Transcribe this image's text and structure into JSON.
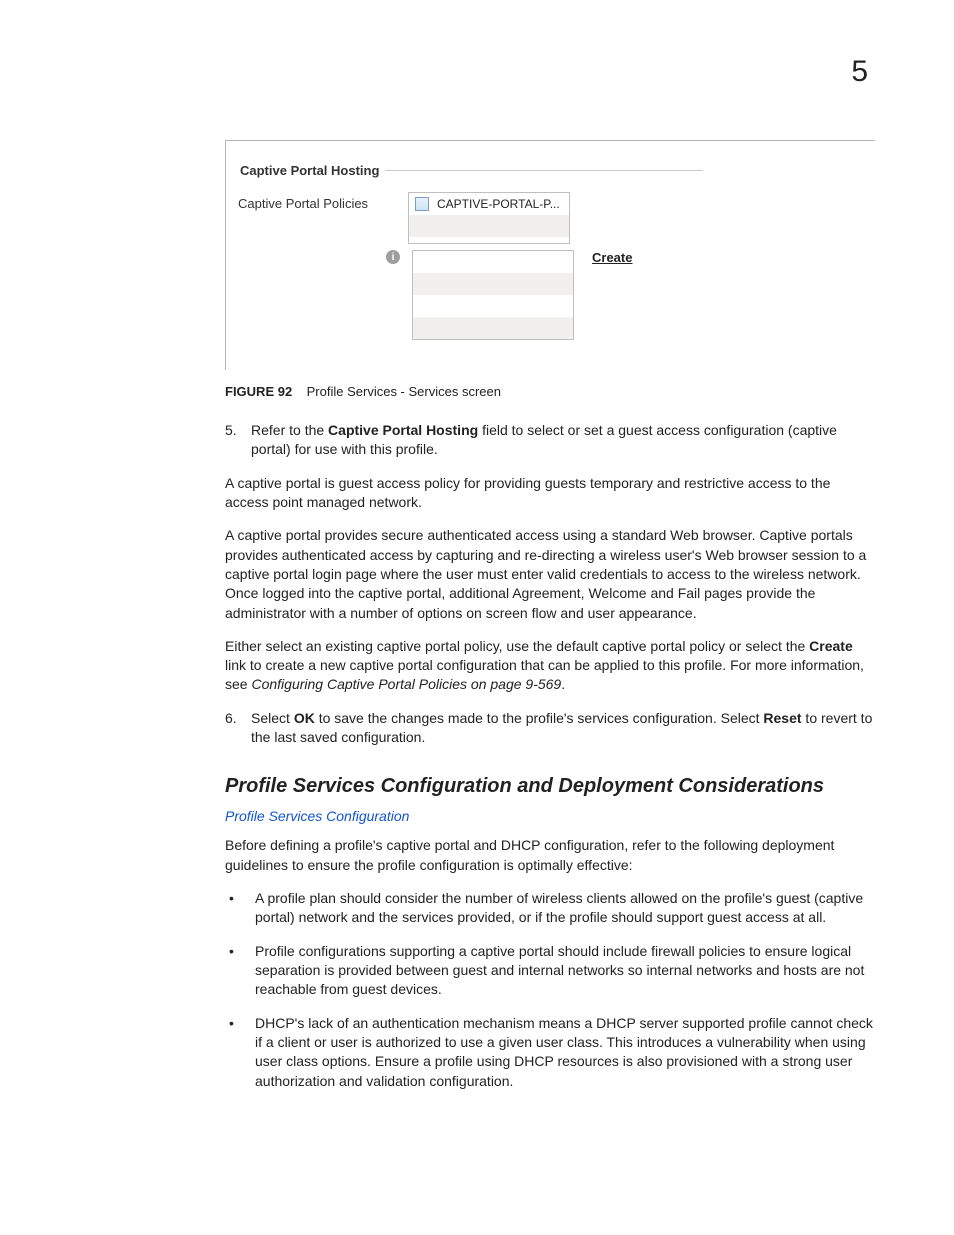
{
  "page_number": "5",
  "figure": {
    "legend": "Captive Portal Hosting",
    "label": "Captive Portal Policies",
    "list_item": "CAPTIVE-PORTAL-P...",
    "create": "Create",
    "caption_prefix": "FIGURE 92",
    "caption_text": "Profile Services - Services screen"
  },
  "step5": {
    "num": "5.",
    "pre": "Refer to the ",
    "bold": "Captive Portal Hosting",
    "post": " field to select or set a guest access configuration (captive portal) for use with this profile."
  },
  "para1": "A captive portal is guest access policy for providing guests temporary and restrictive access to the access point managed network.",
  "para2": "A captive portal provides secure authenticated access using a standard Web browser. Captive portals provides authenticated access by capturing and re-directing a wireless user's Web browser session to a captive portal login page where the user must enter valid credentials to access to the wireless network. Once logged into the captive portal, additional Agreement, Welcome and Fail pages provide the administrator with a number of options on screen flow and user appearance.",
  "para3": {
    "pre": "Either select an existing captive portal policy, use the default captive portal policy or select the ",
    "bold": "Create",
    "mid": " link to create a new captive portal configuration that can be applied to this profile. For more information, see ",
    "italic": "Configuring Captive Portal Policies on page 9-569",
    "post": "."
  },
  "step6": {
    "num": "6.",
    "pre": "Select ",
    "b1": "OK",
    "mid": " to save the changes made to the profile's services configuration. Select ",
    "b2": "Reset",
    "post": " to revert to the last saved configuration."
  },
  "section_heading": "Profile Services Configuration and Deployment Considerations",
  "subsection_link": "Profile Services Configuration",
  "para4": "Before defining a profile's captive portal and DHCP configuration, refer to the following deployment guidelines to ensure the profile configuration is optimally effective:",
  "bullets": [
    "A profile plan should consider the number of wireless clients allowed on the profile's guest (captive portal) network and the services provided, or if the profile should support guest access at all.",
    "Profile configurations supporting a captive portal should include firewall policies to ensure logical separation is provided between guest and internal networks so internal networks and hosts are not reachable from guest devices.",
    "DHCP's lack of an authentication mechanism means a DHCP server supported profile cannot check if a client or user is authorized to use a given user class. This introduces a vulnerability when using user class options. Ensure a profile using DHCP resources is also provisioned with a strong user authorization and validation configuration."
  ]
}
